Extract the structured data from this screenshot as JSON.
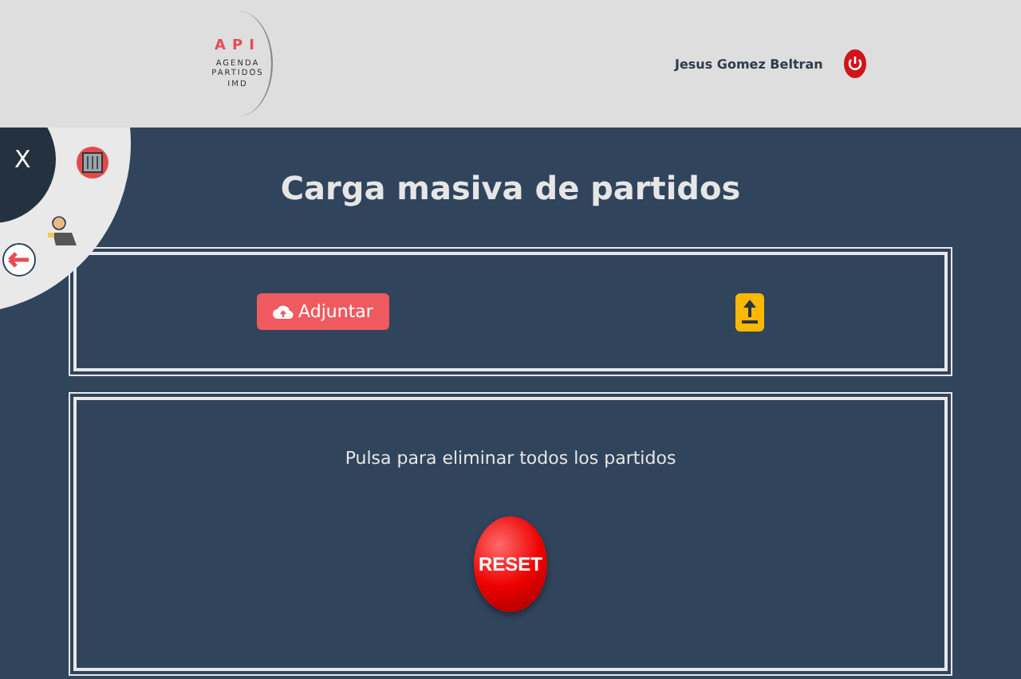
{
  "header": {
    "logo": {
      "title": "API",
      "subtitle": "AGENDA PARTIDOS IMD"
    },
    "user_name": "Jesus Gomez Beltran"
  },
  "menu": {
    "close_label": "X"
  },
  "page_title": "Carga masiva de partidos",
  "upload_panel": {
    "attach_button": "Adjuntar"
  },
  "reset_panel": {
    "instruction": "Pulsa para eliminar todos los partidos",
    "reset_button": "RESET"
  }
}
